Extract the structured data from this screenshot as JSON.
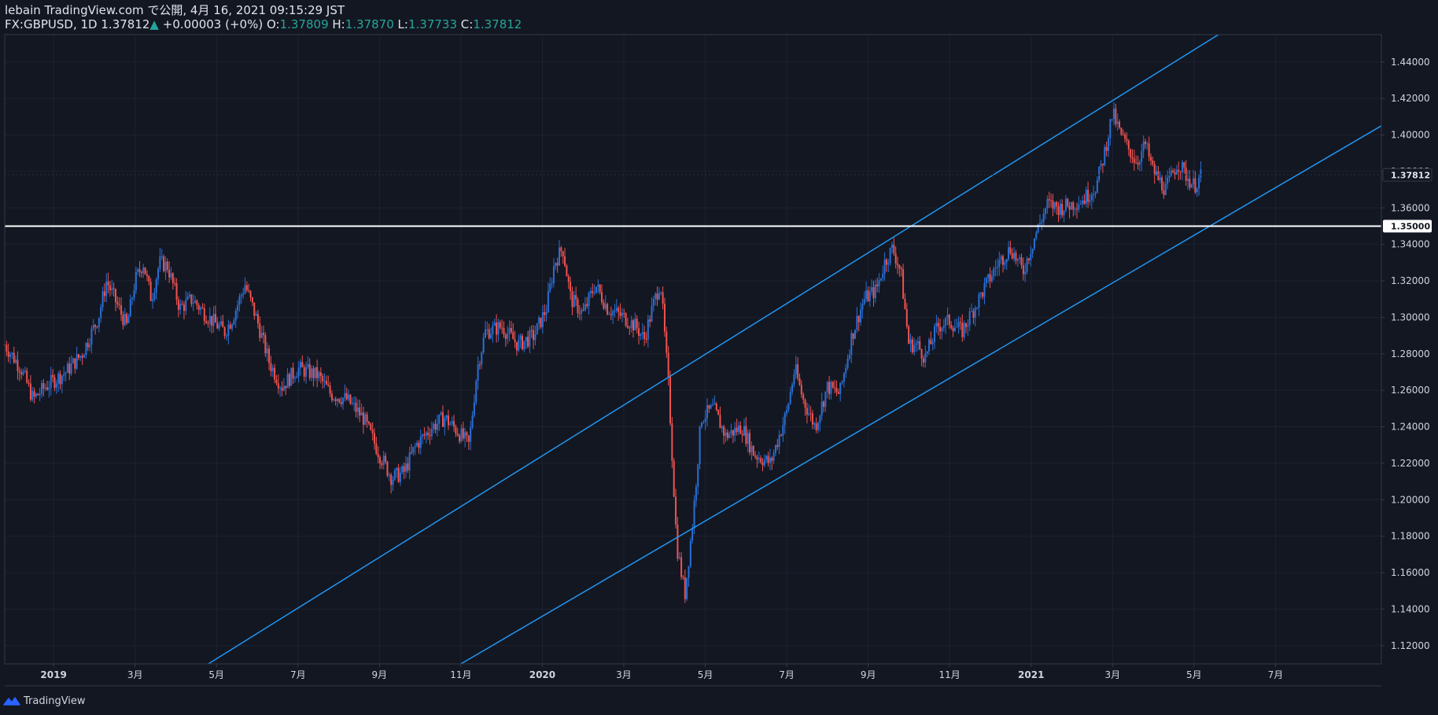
{
  "header": {
    "line1": "lebain TradingView.com で公開, 4月 16, 2021 09:15:29 JST",
    "symbol": "FX:GBPUSD, 1D",
    "last": "1.37812",
    "arrow": "▲",
    "change": "+0.00003 (+0%)",
    "o_label": "O:",
    "o_value": "1.37809",
    "h_label": "H:",
    "h_value": "1.37870",
    "l_label": "L:",
    "l_value": "1.37733",
    "c_label": "C:",
    "c_value": "1.37812"
  },
  "footer": {
    "brand": "TradingView",
    "icon": "tradingview-logo-icon"
  },
  "colors": {
    "background": "#131722",
    "up": "#2a6fd6",
    "down": "#ef5350",
    "trendline": "#2196f3",
    "hline": "#ffffff",
    "grid": "#1e2230",
    "axis_border": "#363a45"
  },
  "chart_data": {
    "type": "candlestick",
    "symbol": "FX:GBPUSD",
    "interval": "1D",
    "ylim": [
      1.11,
      1.455
    ],
    "y_ticks": [
      "1.44000",
      "1.42000",
      "1.40000",
      "1.38000",
      "1.36000",
      "1.34000",
      "1.32000",
      "1.30000",
      "1.28000",
      "1.26000",
      "1.24000",
      "1.22000",
      "1.20000",
      "1.18000",
      "1.16000",
      "1.14000",
      "1.12000"
    ],
    "x_ticks": [
      {
        "label": "2019",
        "t": 0,
        "bold": true
      },
      {
        "label": "3月",
        "t": 2,
        "bold": false
      },
      {
        "label": "5月",
        "t": 4,
        "bold": false
      },
      {
        "label": "7月",
        "t": 6,
        "bold": false
      },
      {
        "label": "9月",
        "t": 8,
        "bold": false
      },
      {
        "label": "11月",
        "t": 10,
        "bold": false
      },
      {
        "label": "2020",
        "t": 12,
        "bold": true
      },
      {
        "label": "3月",
        "t": 14,
        "bold": false
      },
      {
        "label": "5月",
        "t": 16,
        "bold": false
      },
      {
        "label": "7月",
        "t": 18,
        "bold": false
      },
      {
        "label": "9月",
        "t": 20,
        "bold": false
      },
      {
        "label": "11月",
        "t": 22,
        "bold": false
      },
      {
        "label": "2021",
        "t": 24,
        "bold": true
      },
      {
        "label": "3月",
        "t": 26,
        "bold": false
      },
      {
        "label": "5月",
        "t": 28,
        "bold": false
      },
      {
        "label": "7月",
        "t": 30,
        "bold": false
      }
    ],
    "time_unit": "months since 2019-01",
    "xlim": [
      -1.2,
      32.6
    ],
    "last_price": 1.37812,
    "last_price_label": "1.37812",
    "horizontal_line": {
      "price": 1.35,
      "label": "1.35000"
    },
    "trendlines": [
      {
        "points": [
          [
            3.8,
            1.11
          ],
          [
            28.6,
            1.455
          ]
        ]
      },
      {
        "points": [
          [
            10.0,
            1.11
          ],
          [
            32.6,
            1.405
          ]
        ]
      }
    ],
    "price_path": [
      [
        -1.2,
        1.285
      ],
      [
        -0.8,
        1.272
      ],
      [
        -0.5,
        1.255
      ],
      [
        -0.2,
        1.262
      ],
      [
        0.3,
        1.27
      ],
      [
        0.7,
        1.28
      ],
      [
        1.1,
        1.3
      ],
      [
        1.3,
        1.32
      ],
      [
        1.5,
        1.31
      ],
      [
        1.8,
        1.295
      ],
      [
        2.0,
        1.32
      ],
      [
        2.2,
        1.33
      ],
      [
        2.4,
        1.31
      ],
      [
        2.6,
        1.33
      ],
      [
        2.8,
        1.328
      ],
      [
        3.1,
        1.305
      ],
      [
        3.4,
        1.31
      ],
      [
        3.8,
        1.3
      ],
      [
        4.2,
        1.292
      ],
      [
        4.4,
        1.3
      ],
      [
        4.7,
        1.318
      ],
      [
        5.0,
        1.298
      ],
      [
        5.3,
        1.275
      ],
      [
        5.6,
        1.262
      ],
      [
        6.0,
        1.272
      ],
      [
        6.5,
        1.268
      ],
      [
        6.8,
        1.258
      ],
      [
        7.2,
        1.255
      ],
      [
        7.6,
        1.245
      ],
      [
        8.0,
        1.225
      ],
      [
        8.3,
        1.212
      ],
      [
        8.6,
        1.215
      ],
      [
        8.9,
        1.23
      ],
      [
        9.3,
        1.24
      ],
      [
        9.6,
        1.245
      ],
      [
        9.9,
        1.238
      ],
      [
        10.2,
        1.23
      ],
      [
        10.4,
        1.272
      ],
      [
        10.6,
        1.292
      ],
      [
        11.0,
        1.295
      ],
      [
        11.4,
        1.285
      ],
      [
        11.8,
        1.29
      ],
      [
        12.1,
        1.305
      ],
      [
        12.3,
        1.33
      ],
      [
        12.5,
        1.338
      ],
      [
        12.7,
        1.31
      ],
      [
        13.0,
        1.302
      ],
      [
        13.3,
        1.318
      ],
      [
        13.6,
        1.305
      ],
      [
        14.0,
        1.3
      ],
      [
        14.3,
        1.295
      ],
      [
        14.5,
        1.288
      ],
      [
        14.7,
        1.305
      ],
      [
        14.9,
        1.32
      ],
      [
        15.1,
        1.262
      ],
      [
        15.3,
        1.175
      ],
      [
        15.5,
        1.148
      ],
      [
        15.7,
        1.19
      ],
      [
        15.9,
        1.245
      ],
      [
        16.2,
        1.25
      ],
      [
        16.5,
        1.235
      ],
      [
        16.9,
        1.24
      ],
      [
        17.2,
        1.225
      ],
      [
        17.6,
        1.22
      ],
      [
        18.0,
        1.248
      ],
      [
        18.2,
        1.272
      ],
      [
        18.4,
        1.255
      ],
      [
        18.7,
        1.24
      ],
      [
        19.0,
        1.262
      ],
      [
        19.3,
        1.258
      ],
      [
        19.6,
        1.29
      ],
      [
        19.9,
        1.31
      ],
      [
        20.2,
        1.315
      ],
      [
        20.4,
        1.33
      ],
      [
        20.6,
        1.338
      ],
      [
        20.8,
        1.325
      ],
      [
        21.0,
        1.285
      ],
      [
        21.2,
        1.285
      ],
      [
        21.4,
        1.278
      ],
      [
        21.7,
        1.295
      ],
      [
        22.0,
        1.298
      ],
      [
        22.3,
        1.292
      ],
      [
        22.6,
        1.305
      ],
      [
        22.9,
        1.318
      ],
      [
        23.2,
        1.33
      ],
      [
        23.5,
        1.338
      ],
      [
        23.8,
        1.325
      ],
      [
        24.1,
        1.345
      ],
      [
        24.4,
        1.362
      ],
      [
        24.7,
        1.36
      ],
      [
        25.0,
        1.362
      ],
      [
        25.3,
        1.365
      ],
      [
        25.6,
        1.372
      ],
      [
        25.8,
        1.39
      ],
      [
        26.0,
        1.412
      ],
      [
        26.2,
        1.4
      ],
      [
        26.4,
        1.392
      ],
      [
        26.6,
        1.385
      ],
      [
        26.8,
        1.395
      ],
      [
        27.0,
        1.38
      ],
      [
        27.3,
        1.37
      ],
      [
        27.6,
        1.385
      ],
      [
        27.8,
        1.378
      ],
      [
        28.0,
        1.372
      ],
      [
        28.2,
        1.378
      ]
    ]
  }
}
